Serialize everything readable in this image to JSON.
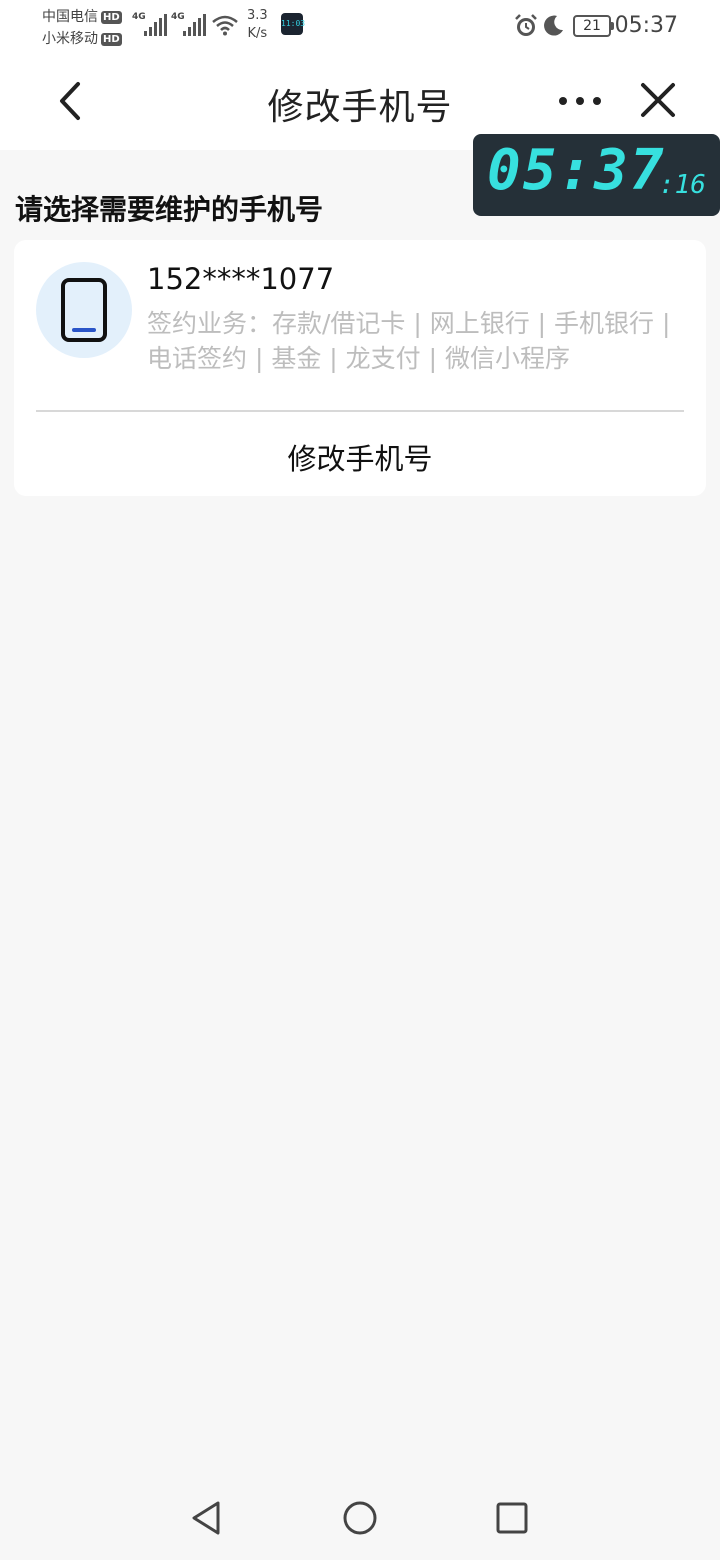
{
  "status_bar": {
    "carrier1": "中国电信",
    "carrier2": "小米移动",
    "hd_badge": "HD",
    "network_type": "4G",
    "speed_value": "3.3",
    "speed_unit": "K/s",
    "battery": "21",
    "time": "05:37"
  },
  "nav": {
    "title": "修改手机号"
  },
  "clock_overlay": {
    "hours_minutes": "05:37",
    "seconds": "16"
  },
  "content": {
    "section_title": "请选择需要维护的手机号",
    "phone": {
      "number": "152****1077",
      "services": "签约业务：存款/借记卡 | 网上银行 | 手机银行 | 电话签约 | 基金 | 龙支付 | 微信小程序",
      "action_label": "修改手机号"
    }
  },
  "colors": {
    "accent_blue": "#2a55c8",
    "avatar_bg": "#e3f0fb",
    "clock_digits": "#37e0df",
    "muted_text": "#bdbdbd"
  }
}
